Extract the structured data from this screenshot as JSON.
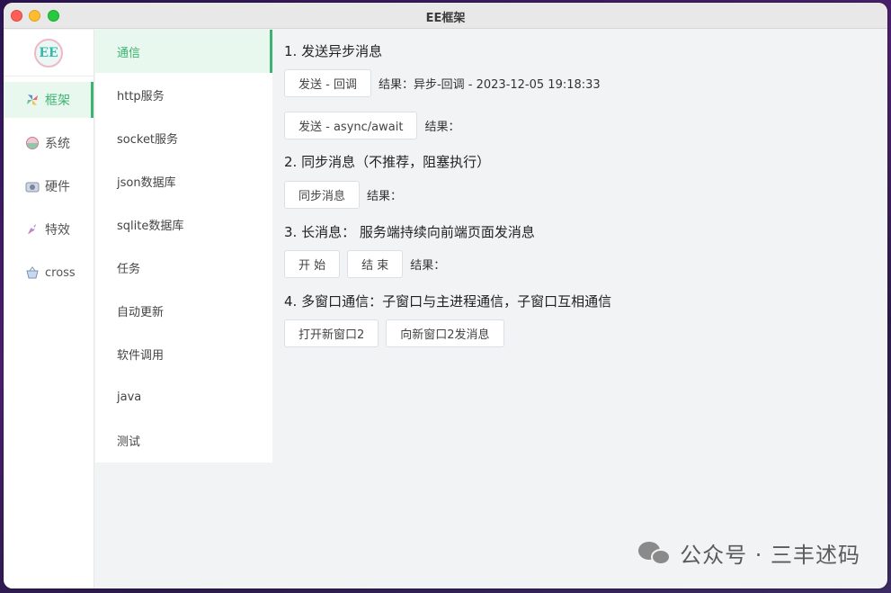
{
  "window": {
    "title": "EE框架"
  },
  "nav1": {
    "logo_text": "EE",
    "items": [
      {
        "label": "框架",
        "icon": "pinwheel-icon"
      },
      {
        "label": "系统",
        "icon": "bowl-icon"
      },
      {
        "label": "硬件",
        "icon": "camera-icon"
      },
      {
        "label": "特效",
        "icon": "rocket-icon"
      },
      {
        "label": "cross",
        "icon": "basket-icon"
      }
    ]
  },
  "nav2": {
    "items": [
      {
        "label": "通信"
      },
      {
        "label": "http服务"
      },
      {
        "label": "socket服务"
      },
      {
        "label": "json数据库"
      },
      {
        "label": "sqlite数据库"
      },
      {
        "label": "任务"
      },
      {
        "label": "自动更新"
      },
      {
        "label": "软件调用"
      },
      {
        "label": "java"
      },
      {
        "label": "测试"
      }
    ]
  },
  "content": {
    "s1": {
      "title": "1. 发送异步消息",
      "btn_callback": "发送 - 回调",
      "result_callback": "结果：异步-回调 - 2023-12-05 19:18:33",
      "btn_async": "发送 - async/await",
      "result_async": "结果："
    },
    "s2": {
      "title": "2. 同步消息（不推荐，阻塞执行）",
      "btn_sync": "同步消息",
      "result_sync": "结果："
    },
    "s3": {
      "title": "3. 长消息： 服务端持续向前端页面发消息",
      "btn_start": "开 始",
      "btn_end": "结 束",
      "result_long": "结果："
    },
    "s4": {
      "title": "4. 多窗口通信：子窗口与主进程通信，子窗口互相通信",
      "btn_open": "打开新窗口2",
      "btn_send": "向新窗口2发消息"
    }
  },
  "watermark": {
    "text": "公众号 · 三丰述码"
  },
  "colors": {
    "accent": "#3cb371",
    "active_bg": "#e8f8ee"
  }
}
